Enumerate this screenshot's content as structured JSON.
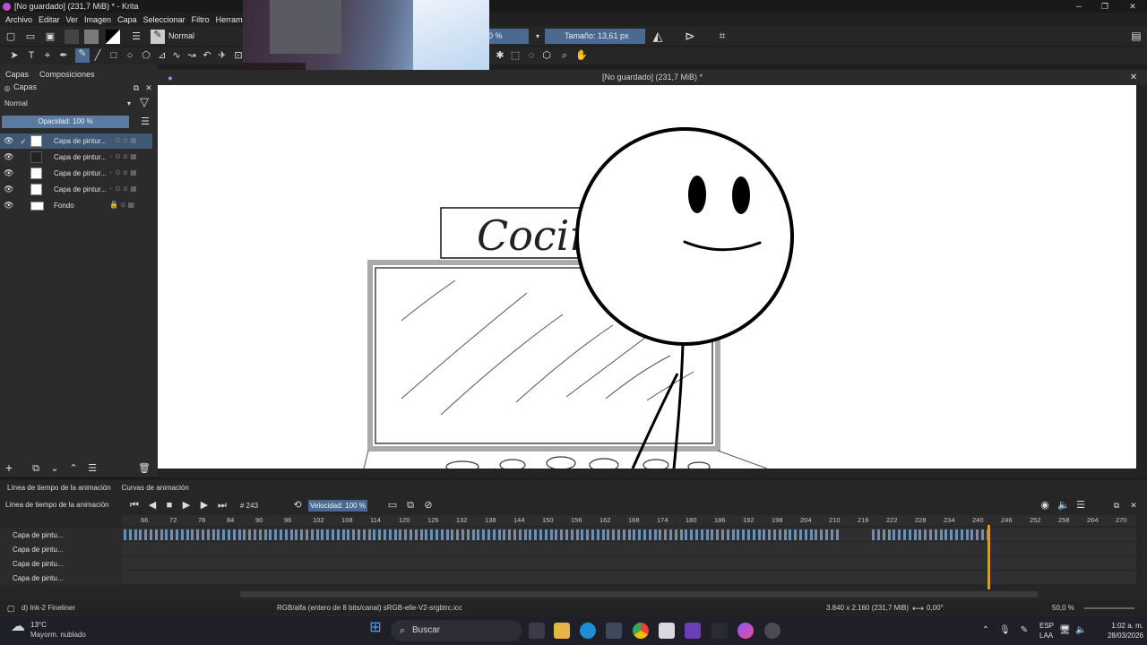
{
  "window": {
    "title": "[No guardado]  (231,7 MiB) * - Krita"
  },
  "menu": [
    "Archivo",
    "Editar",
    "Ver",
    "Imagen",
    "Capa",
    "Seleccionar",
    "Filtro",
    "Herramient"
  ],
  "toolbar": {
    "blend_mode": "Normal",
    "opacity_value": "0 %",
    "size_label": "Tamaño: 13,61 px"
  },
  "docker": {
    "tabs": [
      "Capas",
      "Composiciones"
    ],
    "panel_title": "Capas",
    "blend_mode": "Normal",
    "opacity_label": "Opacidad:  100 %",
    "layers": [
      {
        "name": "Capa de pintur...",
        "selected": true
      },
      {
        "name": "Capa de pintur...",
        "selected": false
      },
      {
        "name": "Capa de pintur...",
        "selected": false
      },
      {
        "name": "Capa de pintur...",
        "selected": false
      },
      {
        "name": "Fondo",
        "selected": false
      }
    ]
  },
  "canvas": {
    "header": "[No guardado]  (231,7 MiB) *",
    "sign_text": "Cocin"
  },
  "animation": {
    "tabs": [
      "Línea de tiempo de la animación",
      "Curvas de animación"
    ],
    "panel_title": "Línea de tiempo de la animación",
    "frame": "# 243",
    "speed": "Velocidad: 100 %",
    "ruler_ticks": [
      "66",
      "72",
      "78",
      "84",
      "90",
      "96",
      "102",
      "108",
      "114",
      "120",
      "126",
      "132",
      "138",
      "144",
      "150",
      "156",
      "162",
      "168",
      "174",
      "180",
      "186",
      "192",
      "198",
      "204",
      "210",
      "216",
      "222",
      "228",
      "234",
      "240",
      "246",
      "252",
      "258",
      "264",
      "270"
    ],
    "tracks": [
      "Capa de pintu...",
      "Capa de pintu...",
      "Capa de pintu...",
      "Capa de pintu..."
    ]
  },
  "status": {
    "brush": "d) Ink-2 Fineliner",
    "color_profile": "RGB/alfa (entero de 8 bits/canal)  sRGB-elle-V2-srgbtrc.icc",
    "dimensions": "3.840 x 2.160 (231,7 MiB)",
    "rotation": "0,00°",
    "zoom": "50,0 %"
  },
  "taskbar": {
    "weather_temp": "13°C",
    "weather_desc": "Mayorm. nublado",
    "search": "Buscar",
    "lang": "ESP",
    "lang_sub": "LAA",
    "time": "1:02 a. m.",
    "date": "28/03/2026"
  }
}
